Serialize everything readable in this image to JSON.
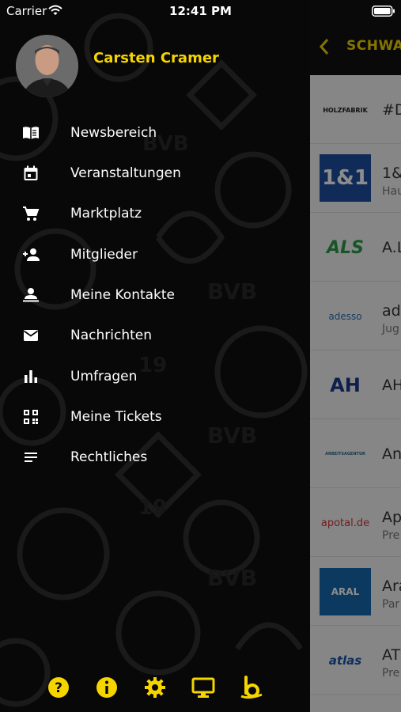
{
  "status_bar": {
    "carrier": "Carrier",
    "time": "12:41 PM"
  },
  "profile": {
    "name": "Carsten Cramer"
  },
  "menu": {
    "items": [
      {
        "label": "Newsbereich",
        "icon": "open-book-icon"
      },
      {
        "label": "Veranstaltungen",
        "icon": "calendar-icon"
      },
      {
        "label": "Marktplatz",
        "icon": "cart-icon"
      },
      {
        "label": "Mitglieder",
        "icon": "add-person-icon"
      },
      {
        "label": "Meine Kontakte",
        "icon": "contact-person-icon"
      },
      {
        "label": "Nachrichten",
        "icon": "mail-icon"
      },
      {
        "label": "Umfragen",
        "icon": "bar-chart-icon"
      },
      {
        "label": "Meine Tickets",
        "icon": "qr-code-icon"
      },
      {
        "label": "Rechtliches",
        "icon": "document-lines-icon"
      }
    ]
  },
  "bottom_bar": {
    "icons": [
      "help-icon",
      "info-icon",
      "settings-icon",
      "monitor-icon",
      "brand-b-icon"
    ]
  },
  "background": {
    "header_title": "SCHWA",
    "list": [
      {
        "logo": "HOLZFABRIK",
        "name": "#D",
        "sub": ""
      },
      {
        "logo": "1&1",
        "name": "1&",
        "sub": "Hau"
      },
      {
        "logo": "ALS",
        "name": "A.L",
        "sub": ""
      },
      {
        "logo": "adesso",
        "name": "ad",
        "sub": "Jug"
      },
      {
        "logo": "AH",
        "name": "AH",
        "sub": ""
      },
      {
        "logo": "ARBEITSAGENTUR",
        "name": "An",
        "sub": ""
      },
      {
        "logo": "apotal.de",
        "name": "Ap",
        "sub": "Pre"
      },
      {
        "logo": "ARAL",
        "name": "Ara",
        "sub": "Par"
      },
      {
        "logo": "atlas",
        "name": "AT",
        "sub": "Pre"
      }
    ]
  },
  "colors": {
    "accent": "#f5d400",
    "drawer_bg": "#080808",
    "text": "#ffffff"
  }
}
